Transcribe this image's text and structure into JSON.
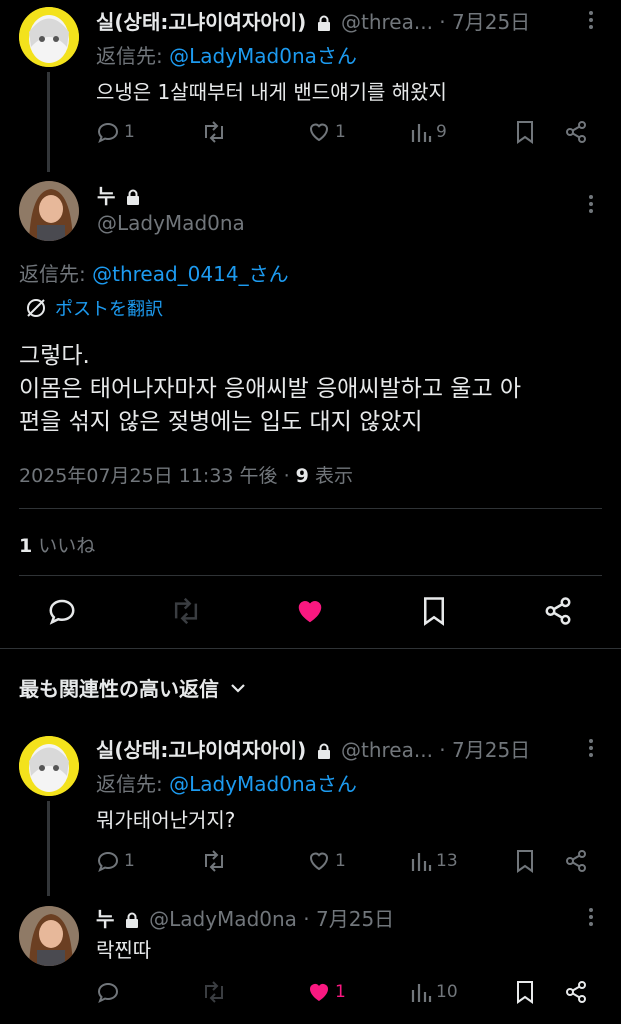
{
  "reply1": {
    "name": "실(상태:고냐이여자아이)",
    "handle": "@threa...",
    "time": "· 7月25日",
    "reply_prefix": "返信先:",
    "reply_to": "@LadyMad0naさん",
    "text": "으냉은 1살때부터 내게 밴드얘기를 해왔지",
    "replies": "1",
    "likes": "1",
    "views": "9"
  },
  "main_post": {
    "name": "누",
    "handle": "@LadyMad0na",
    "reply_prefix": "返信先:",
    "reply_to": "@thread_0414_さん",
    "translate": "ポストを翻訳",
    "text_lines": [
      "그렇다.",
      "이몸은 태어나자마자 응애씨발 응애씨발하고 울고 아",
      "편을 섞지 않은 젖병에는 입도 대지 않았지"
    ],
    "timestamp": "2025年07月25日 11:33 午後 ·",
    "views_count": "9",
    "views_label": "表示",
    "likes_count": "1",
    "likes_label": "いいね"
  },
  "section": {
    "title": "最も関連性の高い返信"
  },
  "reply2": {
    "name": "실(상태:고냐이여자아이)",
    "handle": "@threa...",
    "time": "· 7月25日",
    "reply_prefix": "返信先:",
    "reply_to": "@LadyMad0naさん",
    "text": "뭐가태어난거지?",
    "replies": "1",
    "likes": "1",
    "views": "13"
  },
  "reply3": {
    "name": "누",
    "handle": "@LadyMad0na",
    "time": "· 7月25日",
    "text": "락찐따",
    "likes": "1",
    "views": "10"
  },
  "colors": {
    "accent": "#1d9bf0",
    "like": "#f91880",
    "muted": "#71767b"
  }
}
